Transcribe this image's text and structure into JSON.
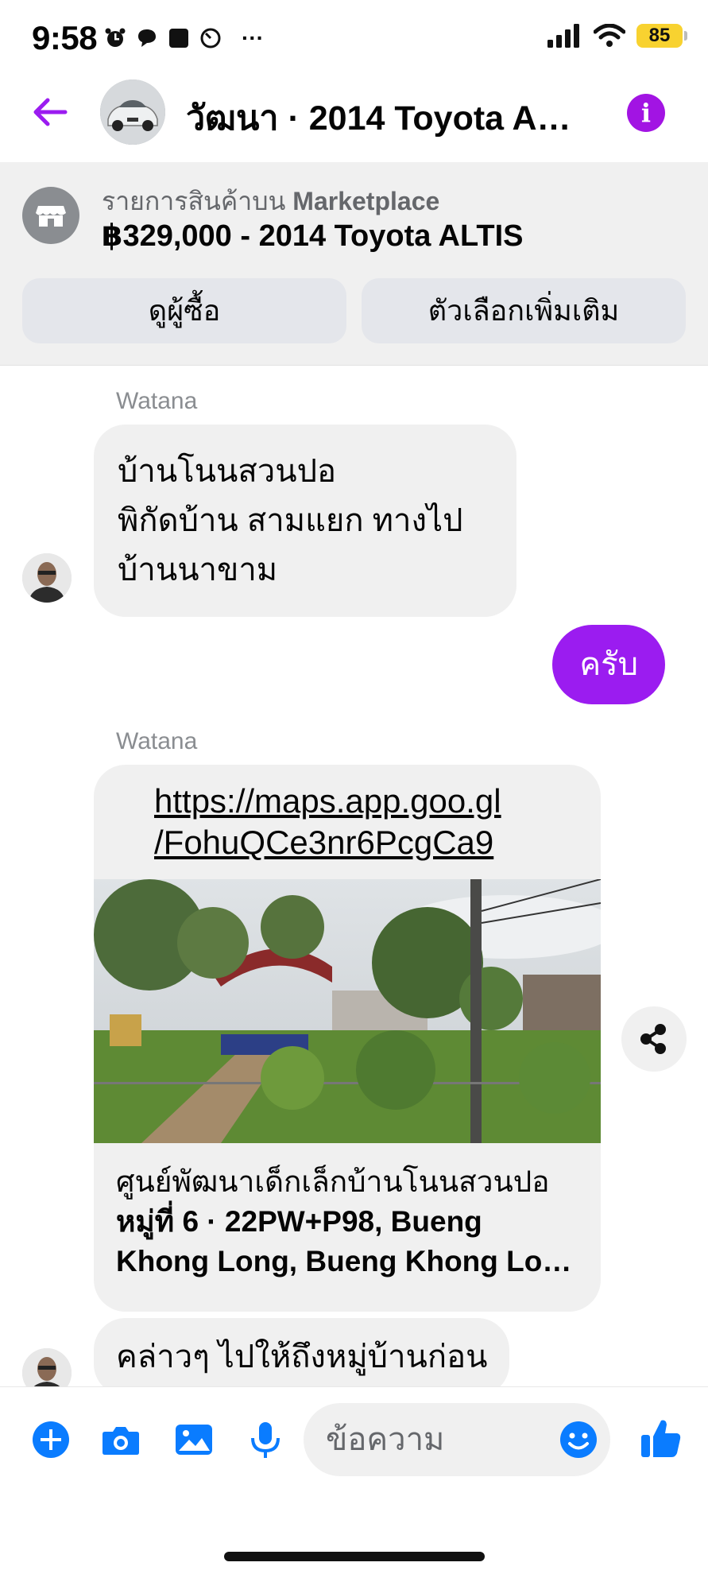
{
  "status_bar": {
    "time": "9:58",
    "icons": [
      "alarm-icon",
      "chat-bubble-icon",
      "stop-square-icon",
      "timer-icon",
      "more-dots-icon"
    ],
    "more": "···",
    "battery": "85"
  },
  "header": {
    "title": "วัฒนา · 2014 Toyota AL…",
    "info": "i"
  },
  "marketplace": {
    "label_prefix": "รายการสินค้าบน",
    "label_brand": "Marketplace",
    "title": "฿329,000 - 2014 Toyota ALTIS",
    "buttons": {
      "view_buyer": "ดูผู้ซื้อ",
      "more_options": "ตัวเลือกเพิ่มเติม"
    }
  },
  "messages": [
    {
      "sender": "Watana",
      "lines": [
        "บ้านโนนสวนปอ",
        "พิกัดบ้าน สามแยก ทางไป",
        "บ้านนาขาม"
      ]
    },
    {
      "outgoing": "ครับ"
    },
    {
      "sender": "Watana",
      "link": {
        "url_line1": "https://maps.app.goo.gl",
        "url_line2": "/FohuQCe3nr6PcgCa9",
        "desc_line1": "ศูนย์พัฒนาเด็กเล็กบ้านโนนสวนปอ",
        "desc_line2": "หมู่ที่ 6 · 22PW+P98, Bueng",
        "desc_line3": "Khong Long, Bueng Khong Lon…"
      }
    },
    {
      "text": "คล่าวๆ ไปให้ถึงหมู่บ้านก่อน"
    }
  ],
  "composer": {
    "placeholder": "ข้อความ"
  },
  "colors": {
    "accent": "#9b1cf0",
    "info": "#a214e3",
    "composer_icons": "#0a7cff",
    "bubble_in": "#f0f0f0"
  }
}
